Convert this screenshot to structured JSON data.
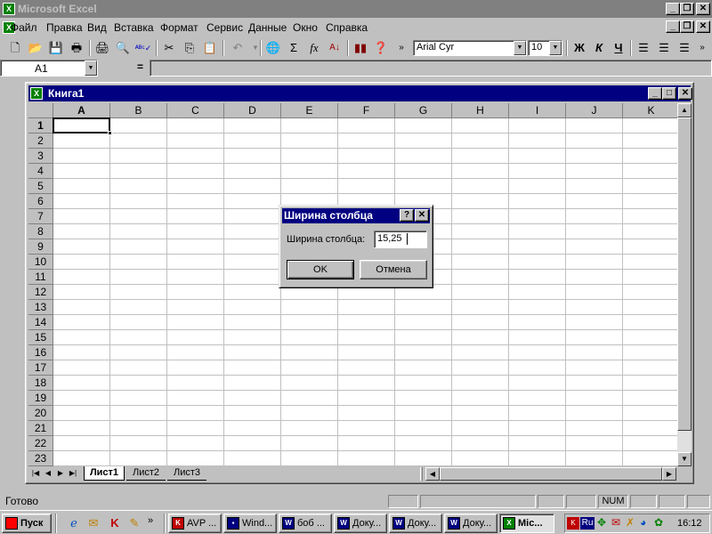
{
  "app": {
    "title": "Microsoft Excel"
  },
  "menu": [
    "Файл",
    "Правка",
    "Вид",
    "Вставка",
    "Формат",
    "Сервис",
    "Данные",
    "Окно",
    "Справка"
  ],
  "toolbar": {
    "font": "Arial Cyr",
    "size": "10",
    "bold": "Ж",
    "italic": "К",
    "underline": "Ч",
    "sum": "Σ",
    "fx": "fx",
    "more": "»"
  },
  "formula_bar": {
    "name_box": "A1",
    "equals": "="
  },
  "workbook": {
    "title": "Книга1",
    "columns": [
      "A",
      "B",
      "C",
      "D",
      "E",
      "F",
      "G",
      "H",
      "I",
      "J",
      "K"
    ],
    "rows": [
      "1",
      "2",
      "3",
      "4",
      "5",
      "6",
      "7",
      "8",
      "9",
      "10",
      "11",
      "12",
      "13",
      "14",
      "15",
      "16",
      "17",
      "18",
      "19",
      "20",
      "21",
      "22",
      "23"
    ],
    "active_cell": "A1",
    "sheets": [
      "Лист1",
      "Лист2",
      "Лист3"
    ],
    "active_sheet": "Лист1"
  },
  "dialog": {
    "title": "Ширина столбца",
    "help": "?",
    "close": "✕",
    "label": "Ширина столбца:",
    "value": "15,25",
    "ok": "OK",
    "cancel": "Отмена"
  },
  "status": {
    "text": "Готово",
    "num": "NUM"
  },
  "taskbar": {
    "start": "Пуск",
    "more": "»",
    "tasks": [
      "AVP ...",
      "Wind...",
      "боб ...",
      "Доку...",
      "Доку...",
      "Доку...",
      "Mic..."
    ],
    "clock": "16:12",
    "lang": "Ru"
  },
  "colors": {
    "titlebar_active": "#000080",
    "titlebar_inactive": "#808080",
    "face": "#c0c0c0",
    "grid": "#c0c0c0"
  }
}
